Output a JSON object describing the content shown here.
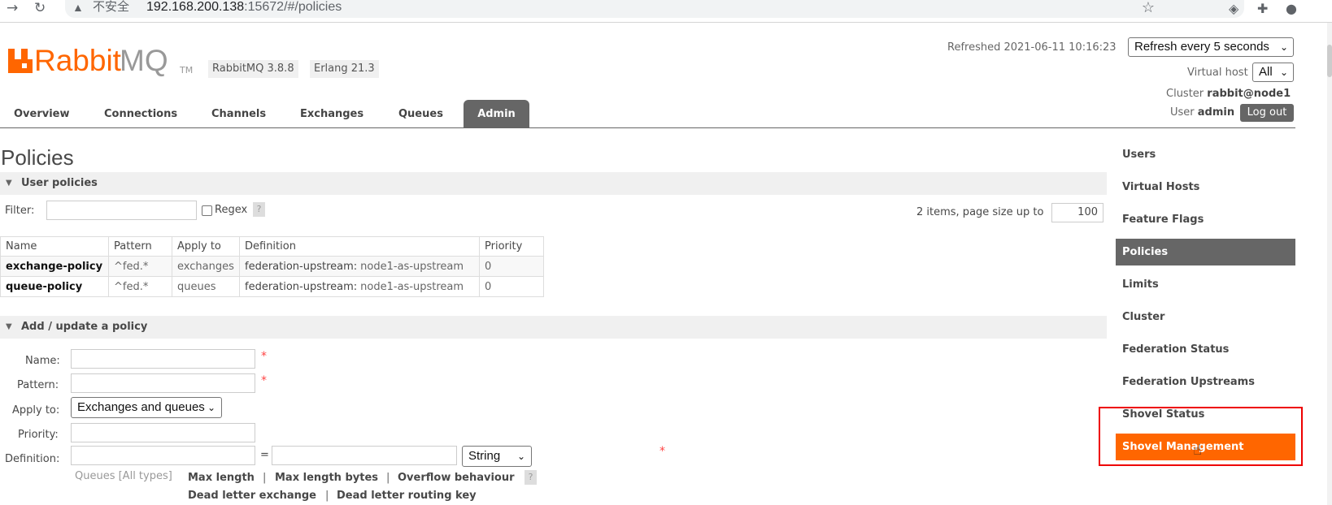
{
  "browser": {
    "back_icon": "arrow-right-icon",
    "insecure_label": "不安全",
    "url_host": "192.168.200.138",
    "url_path": ":15672/#/policies"
  },
  "header": {
    "logo_rabbit": "Rabbit",
    "logo_mq": "MQ",
    "logo_tm": "TM",
    "version": "RabbitMQ 3.8.8",
    "erlang": "Erlang 21.3",
    "refreshed": "Refreshed 2021-06-11 10:16:23",
    "refresh_select": "Refresh every 5 seconds",
    "vhost_label": "Virtual host",
    "vhost_value": "All",
    "cluster_label": "Cluster",
    "cluster_value": "rabbit@node1",
    "user_label": "User",
    "user_value": "admin",
    "logout": "Log out"
  },
  "tabs": [
    "Overview",
    "Connections",
    "Channels",
    "Exchanges",
    "Queues",
    "Admin"
  ],
  "page": {
    "title": "Policies",
    "user_policies_header": "User policies",
    "filter_label": "Filter:",
    "regex_label": "Regex",
    "help": "?",
    "items_text": "2 items, page size up to",
    "page_size": "100",
    "table": {
      "headers": [
        "Name",
        "Pattern",
        "Apply to",
        "Definition",
        "Priority"
      ],
      "rows": [
        {
          "name": "exchange-policy",
          "pattern": "^fed.*",
          "apply_to": "exchanges",
          "def_key": "federation-upstream:",
          "def_value": "node1-as-upstream",
          "priority": "0"
        },
        {
          "name": "queue-policy",
          "pattern": "^fed.*",
          "apply_to": "queues",
          "def_key": "federation-upstream:",
          "def_value": "node1-as-upstream",
          "priority": "0"
        }
      ]
    },
    "add_header": "Add / update a policy",
    "form": {
      "name_label": "Name:",
      "pattern_label": "Pattern:",
      "apply_label": "Apply to:",
      "apply_value": "Exchanges and queues",
      "priority_label": "Priority:",
      "definition_label": "Definition:",
      "equals": "=",
      "type_value": "String",
      "required": "*",
      "queues_hint": "Queues [All types]",
      "keys": [
        "Max length",
        "Max length bytes",
        "Overflow behaviour",
        "Dead letter exchange",
        "Dead letter routing key"
      ],
      "pipe": "|"
    }
  },
  "sidebar": {
    "items": [
      "Users",
      "Virtual Hosts",
      "Feature Flags",
      "Policies",
      "Limits",
      "Cluster",
      "Federation Status",
      "Federation Upstreams",
      "Shovel Status",
      "Shovel Management"
    ]
  }
}
